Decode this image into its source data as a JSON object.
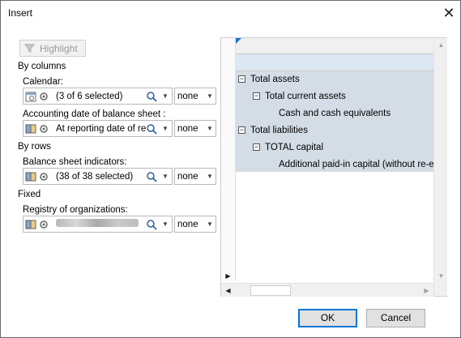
{
  "window": {
    "title": "Insert"
  },
  "toolbar": {
    "highlight_label": "Highlight"
  },
  "sections": {
    "by_columns": "By columns",
    "by_rows": "By rows",
    "fixed": "Fixed"
  },
  "fields": {
    "calendar": {
      "label": "Calendar:",
      "value": "(3 of 6 selected)",
      "mode": "none"
    },
    "accounting_date": {
      "label": "Accounting date of balance sheet :",
      "value": "At reporting date of re",
      "mode": "none"
    },
    "balance_indicators": {
      "label": "Balance sheet indicators:",
      "value": "(38 of 38 selected)",
      "mode": "none"
    },
    "registry": {
      "label": "Registry of organizations:",
      "value": "",
      "mode": "none"
    }
  },
  "preview": {
    "rows": [
      {
        "label": "Total assets",
        "indent": 0,
        "toggle": "−"
      },
      {
        "label": "Total current assets",
        "indent": 1,
        "toggle": "−"
      },
      {
        "label": "Cash and cash equivalents",
        "indent": 2,
        "toggle": ""
      },
      {
        "label": "Total liabilities",
        "indent": 0,
        "toggle": "−"
      },
      {
        "label": "TOTAL capital",
        "indent": 1,
        "toggle": "−"
      },
      {
        "label": "Additional paid-in capital (without re-e",
        "indent": 2,
        "toggle": ""
      }
    ]
  },
  "footer": {
    "ok_label": "OK",
    "cancel_label": "Cancel"
  },
  "colors": {
    "accent": "#0078d7",
    "grid_bg": "#d4dde6",
    "header_blue": "#dde6f3"
  }
}
